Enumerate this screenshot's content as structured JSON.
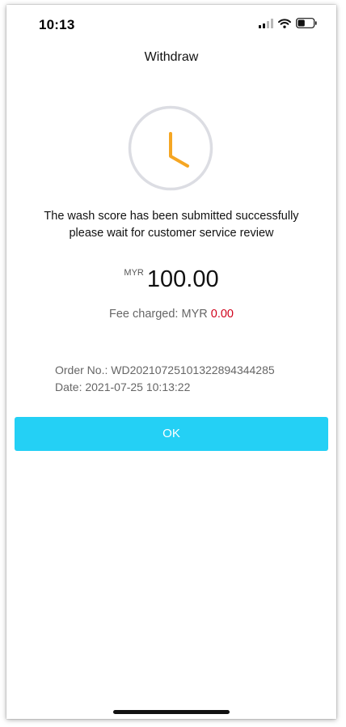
{
  "status_bar": {
    "time": "10:13",
    "icons": [
      "signal-icon",
      "wifi-icon",
      "battery-icon"
    ],
    "battery_level": 0.45
  },
  "header": {
    "title": "Withdraw"
  },
  "status_icon": {
    "name": "clock-icon",
    "ring_color": "#dcdde3",
    "hand_color": "#f5a623"
  },
  "message": {
    "line1": "The wash score has been submitted successfully",
    "line2": "please wait for customer service review"
  },
  "amount": {
    "currency": "MYR",
    "value": "100.00"
  },
  "fee": {
    "label": "Fee charged: MYR ",
    "value": "0.00",
    "value_color": "#d0021b"
  },
  "order": {
    "number_label": "Order No.: ",
    "number": "WD20210725101322894344285",
    "date_label": "Date: ",
    "date": "2021-07-25 10:13:22"
  },
  "actions": {
    "ok_label": "OK",
    "ok_color": "#24d0f5"
  }
}
